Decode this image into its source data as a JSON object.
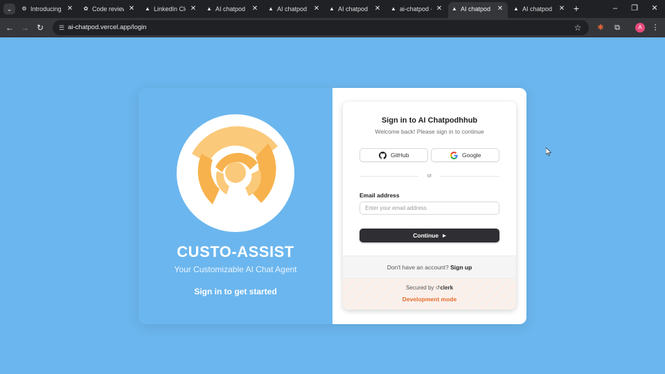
{
  "browser": {
    "tabs": [
      {
        "label": "Introducing C",
        "favicon": "gear-icon",
        "active": false
      },
      {
        "label": "Code review",
        "favicon": "openai-icon",
        "active": false
      },
      {
        "label": "LinkedIn Clon",
        "favicon": "triangle-icon",
        "active": false
      },
      {
        "label": "AI chatpod",
        "favicon": "triangle-icon",
        "active": false
      },
      {
        "label": "AI chatpod",
        "favicon": "triangle-icon",
        "active": false
      },
      {
        "label": "AI chatpod",
        "favicon": "triangle-icon",
        "active": false
      },
      {
        "label": "ai-chatpod -",
        "favicon": "triangle-icon",
        "active": false
      },
      {
        "label": "AI chatpod",
        "favicon": "triangle-icon",
        "active": true
      },
      {
        "label": "AI chatpod",
        "favicon": "triangle-icon",
        "active": false
      }
    ],
    "url": "ai-chatpod.vercel.app/login",
    "profile_initial": "A"
  },
  "left": {
    "brand": "CUSTO-ASSIST",
    "tagline": "Your Customizable AI Chat Agent",
    "cta": "Sign in to get started"
  },
  "signin": {
    "title": "Sign in to AI Chatpodhhub",
    "subtitle": "Welcome back! Please sign in to continue",
    "github_label": "GitHub",
    "google_label": "Google",
    "divider": "or",
    "email_label": "Email address",
    "email_placeholder": "Enter your email address",
    "email_value": "",
    "continue_label": "Continue",
    "no_account": "Don't have an account?",
    "signup_label": "Sign up",
    "secured_by": "Secured by",
    "clerk": "clerk",
    "dev_mode": "Development mode"
  },
  "colors": {
    "background": "#6bb6ee",
    "logo_orange": "#f7b24d",
    "logo_light_orange": "#fbc97a",
    "dev_mode": "#e56b2c",
    "continue_button": "#2f2f33"
  }
}
